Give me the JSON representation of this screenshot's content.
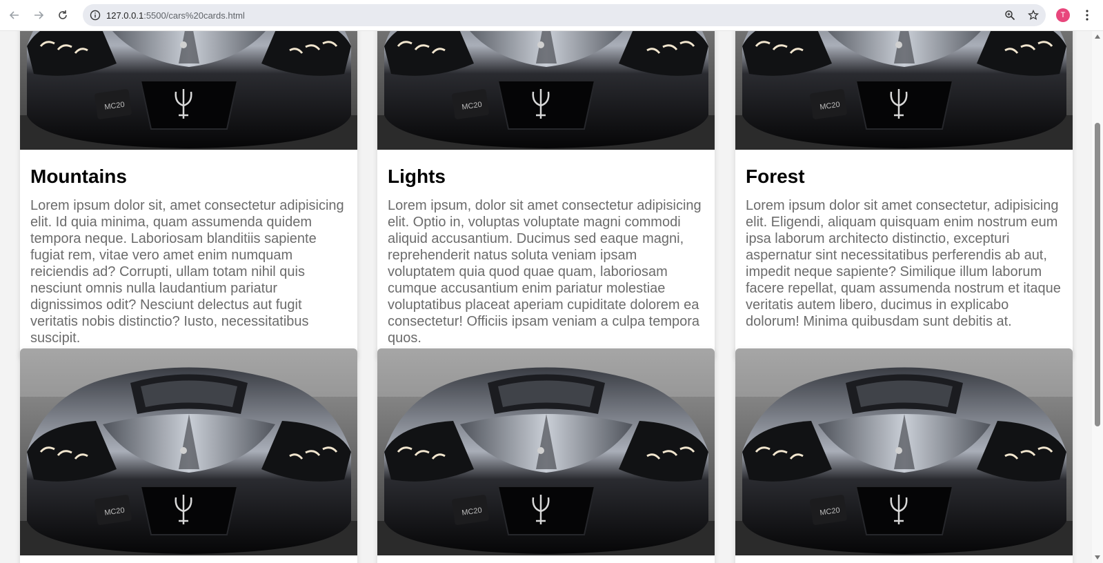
{
  "browser": {
    "url_host": "127.0.0.1",
    "url_path": ":5500/cars%20cards.html",
    "avatar_letter": "T"
  },
  "cards": [
    {
      "title": "Mountains",
      "text": "Lorem ipsum dolor sit, amet consectetur adipisicing elit. Id quia minima, quam assumenda quidem tempora neque. Laboriosam blanditiis sapiente fugiat rem, vitae vero amet enim numquam reiciendis ad? Corrupti, ullam totam nihil quis nesciunt omnis nulla laudantium pariatur dignissimos odit? Nesciunt delectus aut fugit veritatis nobis distinctio? Iusto, necessitatibus suscipit."
    },
    {
      "title": "Lights",
      "text": "Lorem ipsum, dolor sit amet consectetur adipisicing elit. Optio in, voluptas voluptate magni commodi aliquid accusantium. Ducimus sed eaque magni, reprehenderit natus soluta veniam ipsam voluptatem quia quod quae quam, laboriosam cumque accusantium enim pariatur molestiae voluptatibus placeat aperiam cupiditate dolorem ea consectetur! Officiis ipsam veniam a culpa tempora quos."
    },
    {
      "title": "Forest",
      "text": "Lorem ipsum dolor sit amet consectetur, adipisicing elit. Eligendi, aliquam quisquam enim nostrum eum ipsa laborum architecto distinctio, excepturi aspernatur sint necessitatibus perferendis ab aut, impedit neque sapiente? Similique illum laborum facere repellat, quam assumenda nostrum et itaque veritatis autem libero, ducimus in explicabo dolorum! Minima quibusdam sunt debitis at."
    }
  ],
  "car_badge": "MC20",
  "icons": {
    "back": "back-arrow-icon",
    "forward": "forward-arrow-icon",
    "reload": "reload-icon",
    "site_info": "site-info-icon",
    "zoom": "zoom-icon",
    "bookmark": "star-icon",
    "menu": "kebab-menu-icon"
  },
  "colors": {
    "avatar": "#e8467c",
    "body_text": "#6b6b6b"
  }
}
